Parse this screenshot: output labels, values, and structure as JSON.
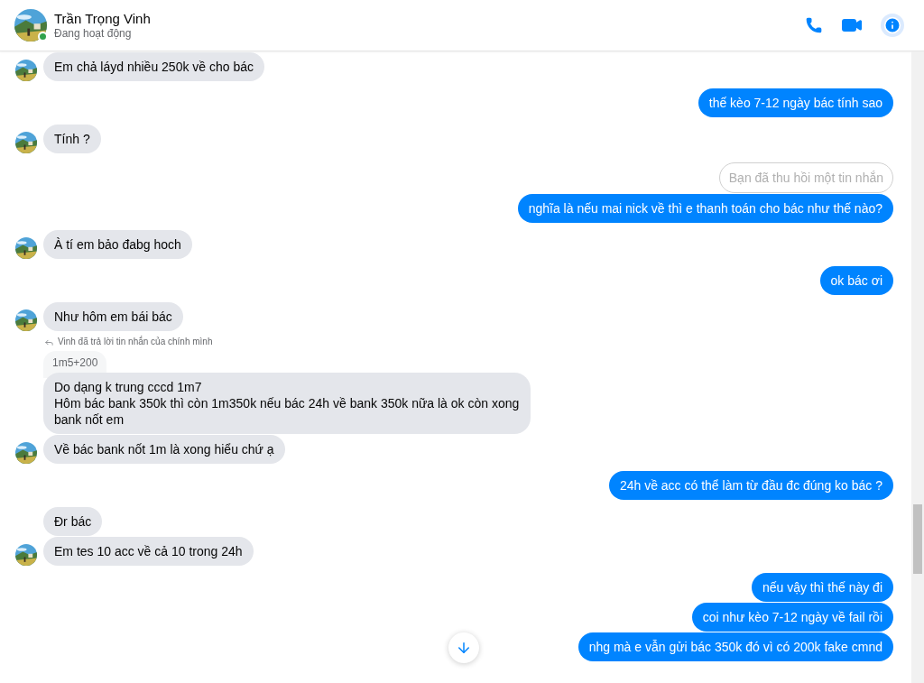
{
  "header": {
    "name": "Trần Trọng Vinh",
    "status": "Đang hoạt động",
    "online": true
  },
  "messages": [
    {
      "kind": "incoming",
      "text": "Em chả láyd nhiều 250k về cho bác",
      "show_avatar": true
    },
    {
      "kind": "outgoing",
      "text": "thế kèo 7-12 ngày bác tính sao"
    },
    {
      "kind": "incoming",
      "text": "Tính ?",
      "show_avatar": true
    },
    {
      "kind": "recalled",
      "text": "Bạn đã thu hồi một tin nhắn"
    },
    {
      "kind": "outgoing",
      "text": "nghĩa là nếu mai nick về thì e thanh toán cho bác như thế nào?"
    },
    {
      "kind": "incoming",
      "text": "À tí em bảo đabg hoch",
      "show_avatar": true
    },
    {
      "kind": "outgoing",
      "text": "ok bác ơi"
    },
    {
      "kind": "incoming",
      "text": "Như hôm em bái bác",
      "show_avatar": true
    },
    {
      "kind": "reply_note",
      "text": "Vinh đã trả lời tin nhắn của chính mình"
    },
    {
      "kind": "quoted",
      "text": "1m5+200"
    },
    {
      "kind": "incoming",
      "text": "Do dạng k trung cccd 1m7\nHôm bác bank 350k thì còn 1m350k nếu bác 24h về bank 350k nữa là ok còn xong bank nốt em",
      "show_avatar": false
    },
    {
      "kind": "incoming",
      "text": "Về bác bank nốt 1m là xong hiểu chứ ạ",
      "show_avatar": true
    },
    {
      "kind": "outgoing",
      "text": "24h về acc có thể làm từ đầu đc đúng ko bác ?"
    },
    {
      "kind": "incoming",
      "text": "Đr bác",
      "show_avatar": false
    },
    {
      "kind": "incoming",
      "text": "Em tes 10 acc về cả 10 trong 24h",
      "show_avatar": true
    },
    {
      "kind": "outgoing",
      "text": "nếu vậy thì thế này đi"
    },
    {
      "kind": "outgoing",
      "text": "coi như kèo 7-12 ngày về fail rồi"
    },
    {
      "kind": "outgoing",
      "text": "nhg mà e vẫn gửi bác 350k đó vì có 200k fake cmnd"
    }
  ]
}
